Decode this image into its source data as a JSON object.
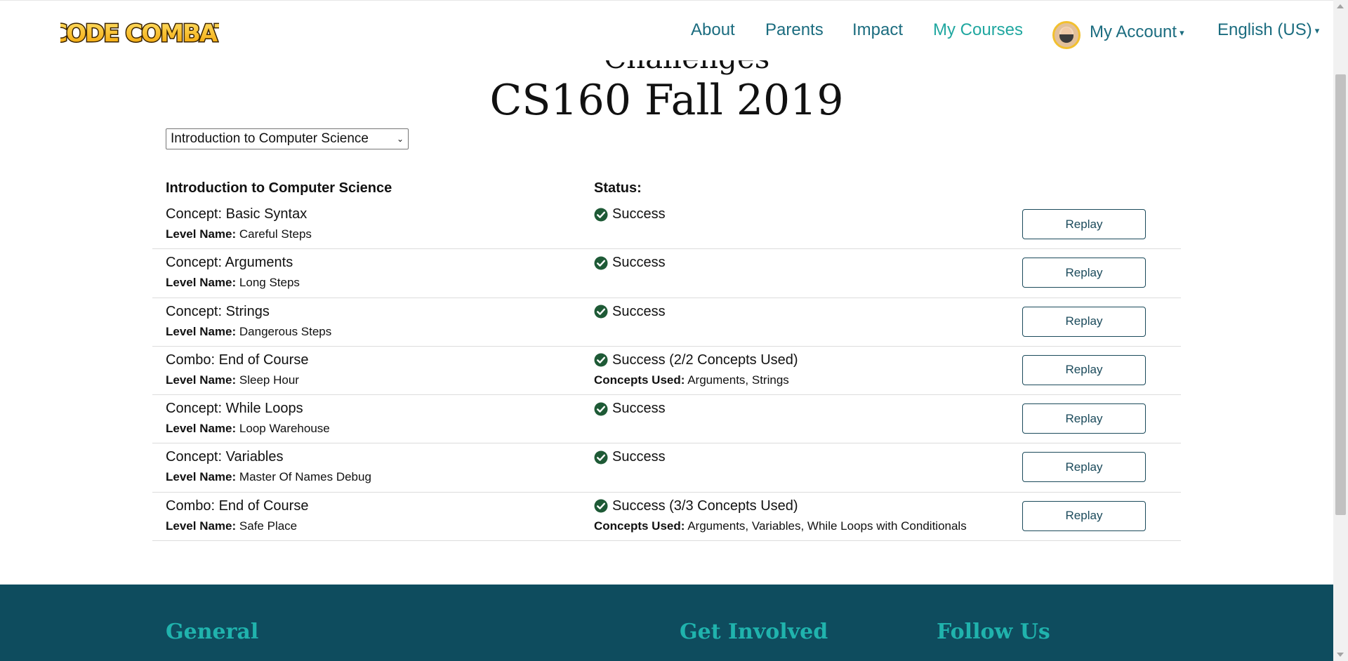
{
  "header": {
    "logo_text": "CODE COMBAT",
    "nav": [
      {
        "label": "About"
      },
      {
        "label": "Parents"
      },
      {
        "label": "Impact"
      },
      {
        "label": "My Courses"
      }
    ],
    "account_label": "My Account",
    "language_label": "English (US)"
  },
  "main": {
    "ghost_title": "Challenges",
    "title": "CS160 Fall 2019",
    "course_select_value": "Introduction to Computer Science",
    "table": {
      "course_header": "Introduction to Computer Science",
      "status_header": "Status:",
      "level_name_label": "Level Name:",
      "concepts_used_label": "Concepts Used:",
      "replay_label": "Replay",
      "rows": [
        {
          "concept": "Concept: Basic Syntax",
          "level": "Careful Steps",
          "status": "Success",
          "concepts_used": ""
        },
        {
          "concept": "Concept: Arguments",
          "level": "Long Steps",
          "status": "Success",
          "concepts_used": ""
        },
        {
          "concept": "Concept: Strings",
          "level": "Dangerous Steps",
          "status": "Success",
          "concepts_used": ""
        },
        {
          "concept": "Combo: End of Course",
          "level": "Sleep Hour",
          "status": "Success (2/2 Concepts Used)",
          "concepts_used": "Arguments, Strings"
        },
        {
          "concept": "Concept: While Loops",
          "level": "Loop Warehouse",
          "status": "Success",
          "concepts_used": ""
        },
        {
          "concept": "Concept: Variables",
          "level": "Master Of Names Debug",
          "status": "Success",
          "concepts_used": ""
        },
        {
          "concept": "Combo: End of Course",
          "level": "Safe Place",
          "status": "Success (3/3 Concepts Used)",
          "concepts_used": "Arguments, Variables, While Loops with Conditionals"
        }
      ]
    }
  },
  "footer": {
    "headings": [
      "General",
      "Get Involved",
      "Follow Us"
    ]
  },
  "colors": {
    "nav_link": "#1b6c7f",
    "nav_active": "#20a7a0",
    "success_check": "#1e5a36",
    "footer_bg": "#0e4c5e",
    "footer_heading": "#20b3ad"
  }
}
